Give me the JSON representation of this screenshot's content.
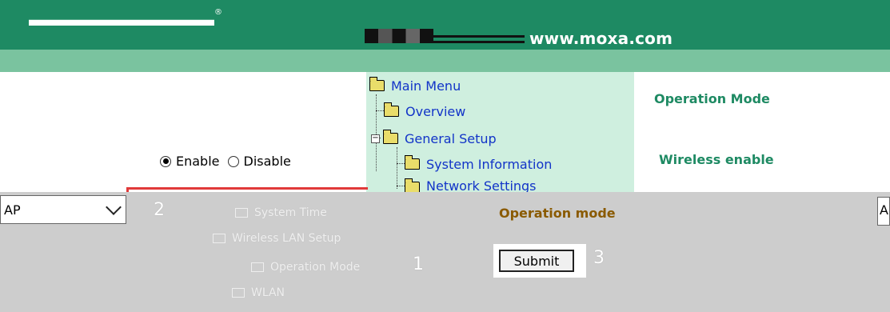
{
  "header": {
    "registered_mark": "®",
    "url": "www.moxa.com"
  },
  "menu": {
    "items": [
      {
        "label": "Main Menu"
      },
      {
        "label": "Overview"
      },
      {
        "label": "General Setup"
      },
      {
        "label": "System Information"
      },
      {
        "label": "Network Settings"
      }
    ],
    "ghost_items": [
      {
        "label": "System Time"
      },
      {
        "label": "Wireless LAN Setup"
      },
      {
        "label": "Operation Mode"
      },
      {
        "label": "WLAN"
      }
    ],
    "expander_minus": "−",
    "expander_plus": "+"
  },
  "labels": {
    "operation_mode_heading": "Operation Mode",
    "wireless_enable": "Wireless enable",
    "operation_mode_field": "Operation mode"
  },
  "radios": {
    "enable": "Enable",
    "disable": "Disable",
    "selected": "Enable"
  },
  "form": {
    "mode_select_value": "AP",
    "right_edge_value": "A",
    "submit_label": "Submit"
  },
  "markers": {
    "one": "1",
    "two": "2",
    "three": "3"
  },
  "colors": {
    "header_green": "#1e8a63",
    "header_light": "#7ac39f",
    "menu_bg": "#cfefdf",
    "label_green": "#1e8a63",
    "field_label_brown": "#8a5a00",
    "panel_gray": "#cdcdcd",
    "link_blue": "#1234c8",
    "annotation_red": "#e03a3a"
  }
}
